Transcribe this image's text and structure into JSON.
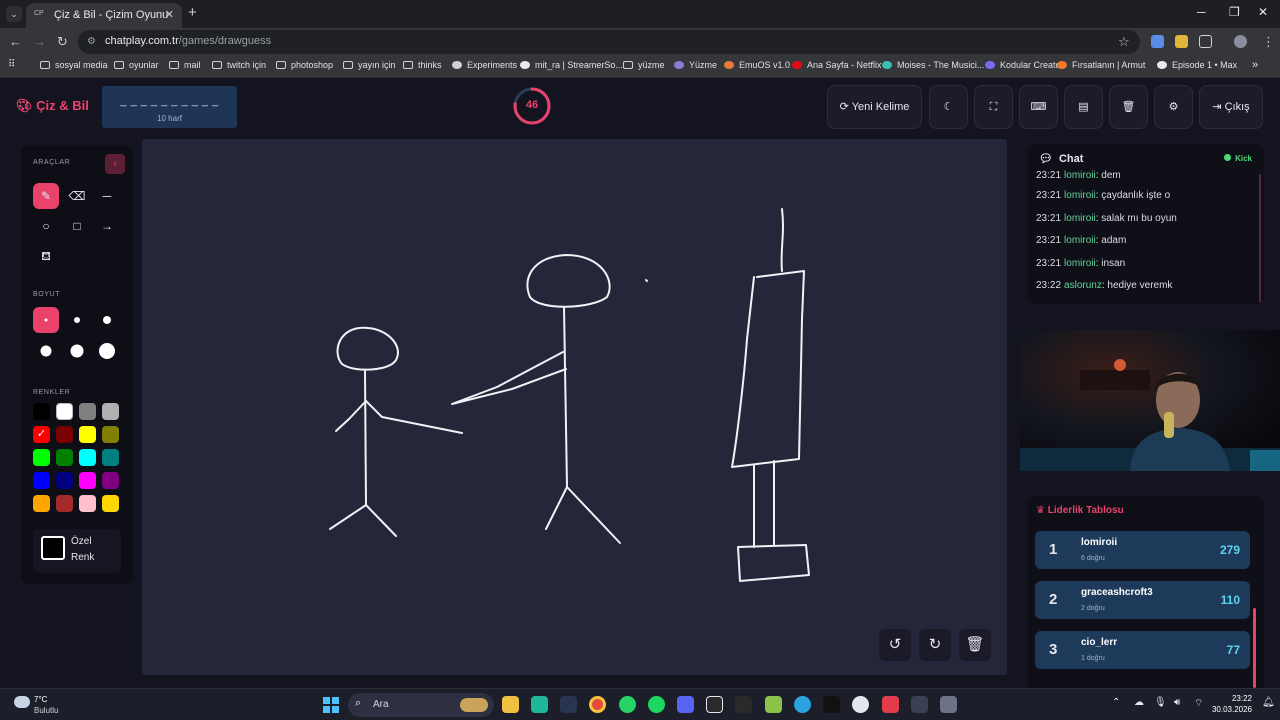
{
  "browser": {
    "tab_title": "Çiz & Bil - Çizim Oyunu",
    "tab_favicon": "CP",
    "url_host": "chatplay.com.tr",
    "url_path": "/games/drawguess",
    "bookmarks": [
      "sosyal media",
      "oyunlar",
      "mail",
      "twitch için",
      "photoshop",
      "yayın için",
      "thinks",
      "Experiments",
      "mit_ra | StreamerSo...",
      "yüzme",
      "Yüzme",
      "EmuOS v1.0",
      "Ana Sayfa - Netflix",
      "Moises - The Musici...",
      "Kodular Creator",
      "Fırsatlanın | Armut",
      "Episode 1 • Max"
    ]
  },
  "header": {
    "logo": "Çiz & Bil",
    "word_hint": "_ _ _ _ _ _ _ _ _ _",
    "word_length": "10 harf",
    "timer": "46",
    "timer_fraction": 0.77,
    "new_word": "Yeni Kelime",
    "exit": "Çıkış",
    "icons": [
      "moon-icon",
      "fullscreen-icon",
      "keyboard-icon",
      "archive-icon",
      "trash-icon",
      "gear-icon"
    ]
  },
  "tools": {
    "tools_title": "ARAÇLAR",
    "size_title": "BOYUT",
    "colors_title": "RENKLER",
    "custom_label": "Özel Renk",
    "colors": [
      "#000000",
      "#ffffff",
      "#808080",
      "#b0b0b0",
      "#ff0000",
      "#7a0000",
      "#ffff00",
      "#808000",
      "#00ff00",
      "#008000",
      "#00ffff",
      "#008080",
      "#0000ff",
      "#000080",
      "#ff00ff",
      "#800080",
      "#ffa500",
      "#a52a2a",
      "#ffc0cb",
      "#ffd700"
    ],
    "selected_color": "#ff0000",
    "accent": "#e9436b"
  },
  "chat": {
    "title": "Chat",
    "platform": "Kick",
    "messages": [
      {
        "time": "23:21",
        "user": "lomiroii",
        "text": ": dem"
      },
      {
        "time": "23:21",
        "user": "lomiroii",
        "text": ": çaydanlık işte o"
      },
      {
        "time": "23:21",
        "user": "lomiroii",
        "text": ": salak mı bu oyun"
      },
      {
        "time": "23:21",
        "user": "lomiroii",
        "text": ": adam"
      },
      {
        "time": "23:21",
        "user": "lomiroii",
        "text": ": insan"
      },
      {
        "time": "23:22",
        "user": "aslorunz",
        "text": ": hediye veremk"
      }
    ]
  },
  "leaderboard": {
    "title": "Liderlik Tablosu",
    "rows": [
      {
        "rank": "1",
        "name": "lomiroii",
        "sub": "6 doğru",
        "score": "279",
        "rank_color": "#f5c842"
      },
      {
        "rank": "2",
        "name": "graceashcroft3",
        "sub": "2 doğru",
        "score": "110",
        "rank_color": "#cfd6e2"
      },
      {
        "rank": "3",
        "name": "cio_lerr",
        "sub": "1 doğru",
        "score": "77",
        "rank_color": "#d4873c"
      }
    ]
  },
  "taskbar": {
    "temp": "7°C",
    "weather": "Bulutlu",
    "search": "Ara",
    "time": "23:22",
    "date": "30.03.2026"
  }
}
